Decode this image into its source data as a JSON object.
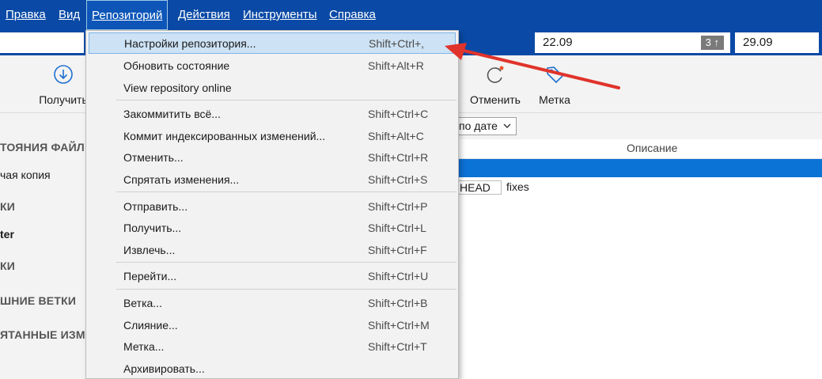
{
  "menubar": {
    "items": [
      "Правка",
      "Вид",
      "Репозиторий",
      "Действия",
      "Инструменты",
      "Справка"
    ]
  },
  "pathbar": {
    "field1": "22.09",
    "field1_badge": "3 ↑",
    "field2": "29.09"
  },
  "toolbar": {
    "pull_label": "Получить",
    "undo_label": "Отменить",
    "tag_label": "Метка"
  },
  "sidebar": {
    "file_status_header": "ТОЯНИЯ ФАЙЛ",
    "working_copy": "чая копия",
    "branches_header": "КИ",
    "master": "ter",
    "tags_header": "КИ",
    "remotes_header": "ШНИЕ ВЕТКИ",
    "stashes_header": "ЯТАННЫЕ ИЗМ"
  },
  "main": {
    "sort_label": "по дате",
    "column_description": "Описание",
    "head_tag": "HEAD",
    "commit_message": "fixes"
  },
  "menu": {
    "items": [
      {
        "label": "Настройки репозитория...",
        "shortcut": "Shift+Ctrl+,"
      },
      {
        "label": "Обновить состояние",
        "shortcut": "Shift+Alt+R"
      },
      {
        "label": "View repository online",
        "shortcut": ""
      },
      {
        "label": "Закоммитить всё...",
        "shortcut": "Shift+Ctrl+C"
      },
      {
        "label": "Коммит индексированных изменений...",
        "shortcut": "Shift+Alt+C"
      },
      {
        "label": "Отменить...",
        "shortcut": "Shift+Ctrl+R"
      },
      {
        "label": "Спрятать изменения...",
        "shortcut": "Shift+Ctrl+S"
      },
      {
        "label": "Отправить...",
        "shortcut": "Shift+Ctrl+P"
      },
      {
        "label": "Получить...",
        "shortcut": "Shift+Ctrl+L"
      },
      {
        "label": "Извлечь...",
        "shortcut": "Shift+Ctrl+F"
      },
      {
        "label": "Перейти...",
        "shortcut": "Shift+Ctrl+U"
      },
      {
        "label": "Ветка...",
        "shortcut": "Shift+Ctrl+B"
      },
      {
        "label": "Слияние...",
        "shortcut": "Shift+Ctrl+M"
      },
      {
        "label": "Метка...",
        "shortcut": "Shift+Ctrl+T"
      },
      {
        "label": "Архивировать...",
        "shortcut": ""
      }
    ]
  },
  "colors": {
    "menubar": "#0a4aa6",
    "selection": "#0b72d6",
    "menu_highlight": "#cde2f4",
    "arrow": "#e0332b",
    "accent_dot": "#f0552a",
    "icon_blue": "#1f6fd0"
  }
}
